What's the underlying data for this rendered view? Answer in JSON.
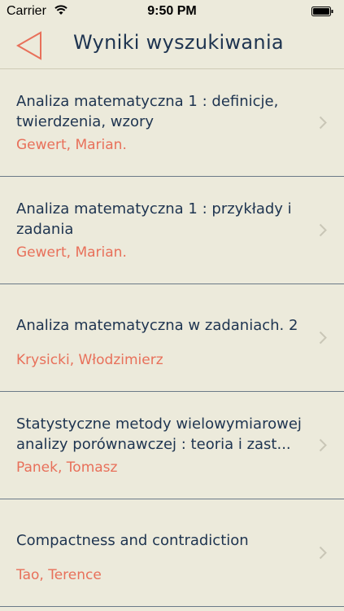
{
  "status_bar": {
    "carrier": "Carrier",
    "time": "9:50 PM"
  },
  "nav": {
    "title": "Wyniki wyszukiwania",
    "back_icon": "back-triangle-icon",
    "accent_color": "#e8705a"
  },
  "results": [
    {
      "title_line1": "Analiza matematyczna 1 : definicje,",
      "title_line2": "twierdzenia, wzory",
      "author": "Gewert, Marian."
    },
    {
      "title_line1": "Analiza matematyczna 1 : przykłady i",
      "title_line2": "zadania",
      "author": "Gewert, Marian."
    },
    {
      "title_line1": "Analiza matematyczna w zadaniach. 2",
      "title_line2": "",
      "author": "Krysicki, Włodzimierz"
    },
    {
      "title_line1": "Statystyczne metody wielowymiarowej",
      "title_line2": "analizy porównawczej : teoria i zast...",
      "author": "Panek, Tomasz"
    },
    {
      "title_line1": "Compactness and contradiction",
      "title_line2": "",
      "author": "Tao, Terence"
    }
  ]
}
